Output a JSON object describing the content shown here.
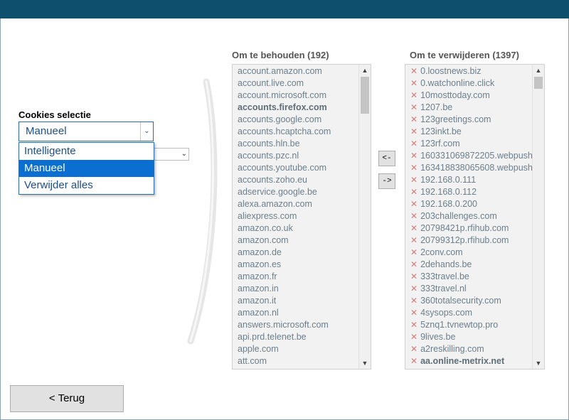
{
  "cookies": {
    "label": "Cookies selectie",
    "selected": "Manueel",
    "options": [
      "Intelligente",
      "Manueel",
      "Verwijder alles"
    ]
  },
  "keep": {
    "title": "Om te behouden (192)",
    "items": [
      {
        "text": "account.amazon.com"
      },
      {
        "text": "account.live.com"
      },
      {
        "text": "account.microsoft.com"
      },
      {
        "text": "accounts.firefox.com",
        "bold": true
      },
      {
        "text": "accounts.google.com"
      },
      {
        "text": "accounts.hcaptcha.com"
      },
      {
        "text": "accounts.hln.be"
      },
      {
        "text": "accounts.pzc.nl"
      },
      {
        "text": "accounts.youtube.com"
      },
      {
        "text": "accounts.zoho.eu"
      },
      {
        "text": "adservice.google.be"
      },
      {
        "text": "alexa.amazon.com"
      },
      {
        "text": "aliexpress.com"
      },
      {
        "text": "amazon.co.uk"
      },
      {
        "text": "amazon.com"
      },
      {
        "text": "amazon.de"
      },
      {
        "text": "amazon.es"
      },
      {
        "text": "amazon.fr"
      },
      {
        "text": "amazon.in"
      },
      {
        "text": "amazon.it"
      },
      {
        "text": "amazon.nl"
      },
      {
        "text": "answers.microsoft.com"
      },
      {
        "text": "api.prd.telenet.be"
      },
      {
        "text": "apple.com"
      },
      {
        "text": "att.com"
      }
    ]
  },
  "remove": {
    "title": "Om te verwijderen (1397)",
    "mark": "✕",
    "items": [
      {
        "text": "0.loostnews.biz"
      },
      {
        "text": "0.watchonline.click"
      },
      {
        "text": "10mosttoday.com"
      },
      {
        "text": "1207.be"
      },
      {
        "text": "123greetings.com"
      },
      {
        "text": "123inkt.be"
      },
      {
        "text": "123rf.com"
      },
      {
        "text": "160331069872205.webpush"
      },
      {
        "text": "163418838065608.webpush"
      },
      {
        "text": "192.168.0.111"
      },
      {
        "text": "192.168.0.112"
      },
      {
        "text": "192.168.0.200"
      },
      {
        "text": "203challenges.com"
      },
      {
        "text": "20798421p.rfihub.com"
      },
      {
        "text": "20799312p.rfihub.com"
      },
      {
        "text": "2conv.com"
      },
      {
        "text": "2dehands.be"
      },
      {
        "text": "333travel.be"
      },
      {
        "text": "333travel.nl"
      },
      {
        "text": "360totalsecurity.com"
      },
      {
        "text": "4sysops.com"
      },
      {
        "text": "5znq1.tvnewtop.pro"
      },
      {
        "text": "9lives.be"
      },
      {
        "text": "a2reskilling.com"
      },
      {
        "text": "aa.online-metrix.net",
        "bold": true
      }
    ]
  },
  "buttons": {
    "move_left": "<-",
    "move_right": "->",
    "back": "< Terug"
  },
  "scroll_arrows": {
    "up": "▲",
    "down": "▼"
  },
  "colors": {
    "titlebar": "#0e4f6e",
    "accent": "#0b6fd1",
    "remove_mark": "#d27c7c"
  }
}
